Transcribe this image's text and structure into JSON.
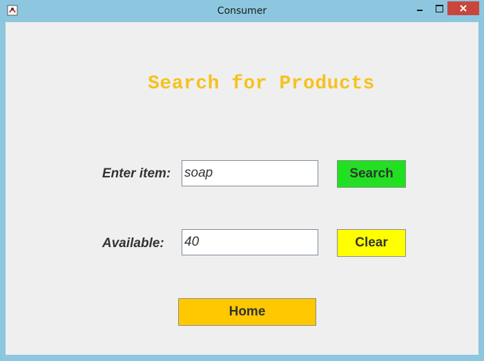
{
  "window": {
    "title": "Consumer",
    "icon": "java-app-icon",
    "controls": [
      "minimize-icon",
      "maximize-icon",
      "close-icon"
    ]
  },
  "page": {
    "heading": "Search for Products"
  },
  "form": {
    "item_label": "Enter item:",
    "item_value": "soap",
    "available_label": "Available:",
    "available_value": "40"
  },
  "buttons": {
    "search_label": "Search",
    "clear_label": "Clear",
    "home_label": "Home"
  },
  "colors": {
    "heading": "#f6c21d",
    "search_button": "#1fe21f",
    "clear_button": "#ffff00",
    "home_button": "#ffc800",
    "titlebar": "#8cc7df",
    "close_button": "#c9463d"
  }
}
